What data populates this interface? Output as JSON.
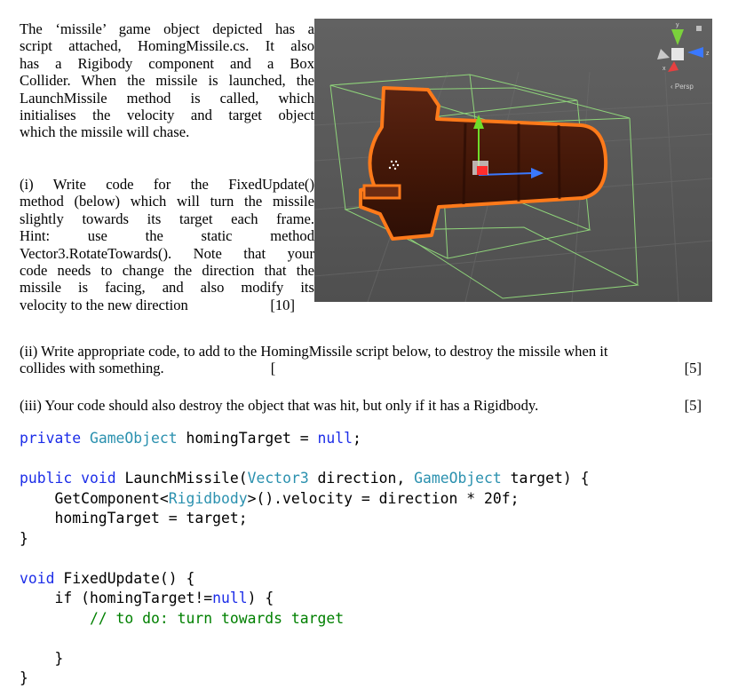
{
  "intro_lines": [
    "The ‘missile’ game object depicted has a",
    "script attached, HomingMissile.cs. It also",
    "has a Rigibody component and a Box",
    "Collider. When the missile is launched, the",
    "LaunchMissile method is called, which",
    "initialises the velocity and target object",
    "which the missile will chase."
  ],
  "q1": {
    "lines": [
      "(i) Write code for the FixedUpdate()",
      "method (below) which will turn the missile",
      "slightly towards its target each frame.",
      "Hint: use the static method",
      "Vector3.RotateTowards(). Note that your",
      "code needs to change the direction that the",
      "missile is facing, and also modify its"
    ],
    "last_line": "velocity to the new direction",
    "marks": "[10]"
  },
  "q2": {
    "line1": "(ii) Write appropriate code, to add to the HomingMissile script below, to destroy the missile when it",
    "line2": "collides with something.",
    "stray_bracket": "[",
    "marks": "[5]"
  },
  "q3": {
    "text": "(iii) Your code should also destroy the object that was hit, but only if it has a Rigidbody.",
    "marks": "[5]"
  },
  "viewport": {
    "projection_label": "‹ Persp",
    "gizmo_axes": {
      "y": "y",
      "z": "z",
      "x": "x"
    },
    "colors": {
      "background": "#5a5a5a",
      "missile_body": "#4a1a0c",
      "outline": "#ff7a1a",
      "bounding_box": "#8fd47a"
    }
  },
  "code": {
    "field": {
      "kw": "private",
      "type": "GameObject",
      "rest": " homingTarget = ",
      "val": "null",
      "end": ";"
    },
    "launch_sig": {
      "kw1": "public",
      "kw2": "void",
      "name": " LaunchMissile(",
      "type1": "Vector3",
      "p1": " direction, ",
      "type2": "GameObject",
      "p2": " target) {"
    },
    "launch_body1": {
      "pre": "    GetComponent<",
      "type": "Rigidbody",
      "post": ">().velocity = direction * 20f;"
    },
    "launch_body2": "    homingTarget = target;",
    "close_brace": "}",
    "fixed_sig": {
      "kw": "void",
      "rest": " FixedUpdate() {"
    },
    "if_line": {
      "pre": "    if (homingTarget!=",
      "val": "null",
      "post": ") {"
    },
    "comment": "        // to do: turn towards target",
    "inner_close": "    }"
  }
}
